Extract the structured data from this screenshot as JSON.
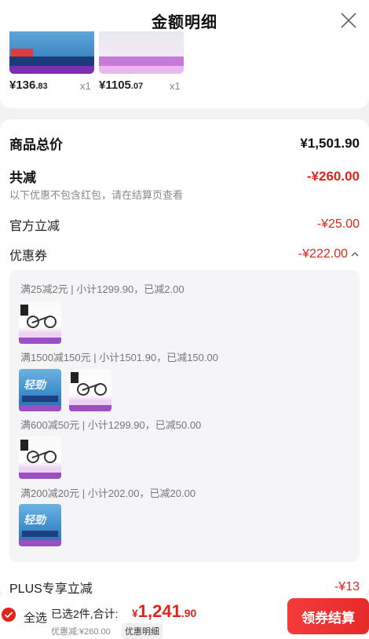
{
  "header": {
    "title": "金额明细"
  },
  "products": [
    {
      "price_int": "¥136",
      "price_dec": ".83",
      "qty": "x1"
    },
    {
      "price_int": "¥1105",
      "price_dec": ".07",
      "qty": "x1"
    }
  ],
  "summary": {
    "total_label": "商品总价",
    "total_value": "¥1,501.90",
    "reduce_label": "共减",
    "reduce_value": "-¥260.00",
    "reduce_note": "以下优惠不包含红包，请在结算页查看",
    "official_label": "官方立减",
    "official_value": "-¥25.00",
    "coupon_label": "优惠券",
    "coupon_value": "-¥222.00",
    "plus_label": "PLUS专享立减",
    "plus_value": "-¥13"
  },
  "coupons": [
    {
      "line": "满25减2元 | 小计1299.90，已减2.00"
    },
    {
      "line": "满1500减150元 | 小计1501.90，已减150.00"
    },
    {
      "line": "满600减50元 | 小计1299.90，已减50.00"
    },
    {
      "line": "满200减20元 | 小计202.00，已减20.00"
    }
  ],
  "footer": {
    "select_all": "全选",
    "selected_text": "已选2件,合计:",
    "total_symbol": "¥",
    "total_int": "1,241",
    "total_dec": ".90",
    "discount_text": "优惠减:¥260.00",
    "detail_label": "优惠明细",
    "checkout_label": "领券结算"
  },
  "colors": {
    "accent": "#e1251b"
  }
}
